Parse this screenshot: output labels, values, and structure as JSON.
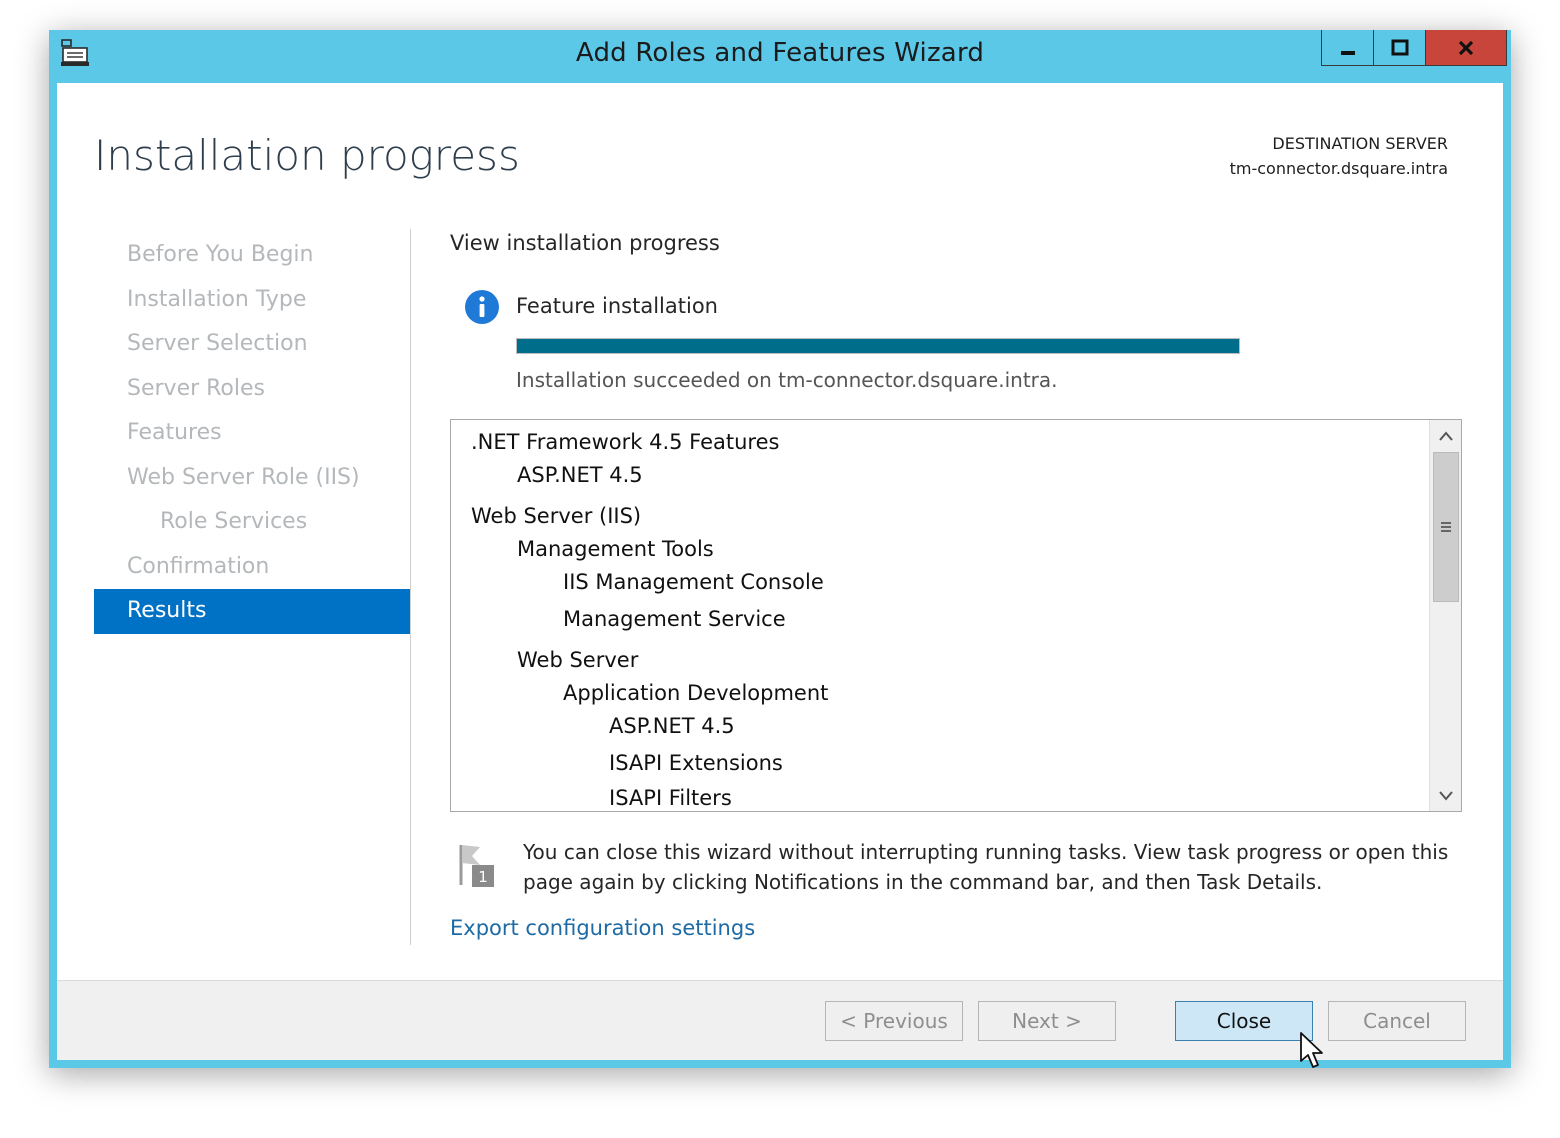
{
  "window": {
    "title": "Add Roles and Features Wizard"
  },
  "page": {
    "title": "Installation progress",
    "destination_label": "DESTINATION SERVER",
    "destination_server": "tm-connector.dsquare.intra"
  },
  "nav": {
    "items": [
      {
        "label": "Before You Begin",
        "state": "inactive"
      },
      {
        "label": "Installation Type",
        "state": "inactive"
      },
      {
        "label": "Server Selection",
        "state": "inactive"
      },
      {
        "label": "Server Roles",
        "state": "inactive"
      },
      {
        "label": "Features",
        "state": "inactive"
      },
      {
        "label": "Web Server Role (IIS)",
        "state": "inactive"
      },
      {
        "label": "Role Services",
        "state": "inactive"
      },
      {
        "label": "Confirmation",
        "state": "inactive"
      },
      {
        "label": "Results",
        "state": "active"
      }
    ]
  },
  "content": {
    "heading": "View installation progress",
    "status_title": "Feature installation",
    "status_icon": "info-icon",
    "progress_fraction": 1.0,
    "result_text": "Installation succeeded on tm-connector.dsquare.intra.",
    "features": [
      {
        "label": ".NET Framework 4.5 Features",
        "level": 0
      },
      {
        "label": "ASP.NET 4.5",
        "level": 1
      },
      {
        "label": "Web Server (IIS)",
        "level": 0
      },
      {
        "label": "Management Tools",
        "level": 1
      },
      {
        "label": "IIS Management Console",
        "level": 2
      },
      {
        "label": "Management Service",
        "level": 2
      },
      {
        "label": "Web Server",
        "level": 1
      },
      {
        "label": "Application Development",
        "level": 2
      },
      {
        "label": "ASP.NET 4.5",
        "level": 3
      },
      {
        "label": "ISAPI Extensions",
        "level": 3
      },
      {
        "label": "ISAPI Filters",
        "level": 3
      }
    ],
    "note": "You can close this wizard without interrupting running tasks. View task progress or open this page again by clicking Notifications in the command bar, and then Task Details.",
    "note_badge": "1",
    "export_link": "Export configuration settings"
  },
  "buttons": {
    "previous": "< Previous",
    "next": "Next >",
    "close": "Close",
    "cancel": "Cancel"
  },
  "colors": {
    "titlebar": "#5bc8e8",
    "nav_active": "#0072c6",
    "progress_fill": "#006e8a",
    "close_caption": "#c7453a",
    "link": "#1d6aa5"
  }
}
